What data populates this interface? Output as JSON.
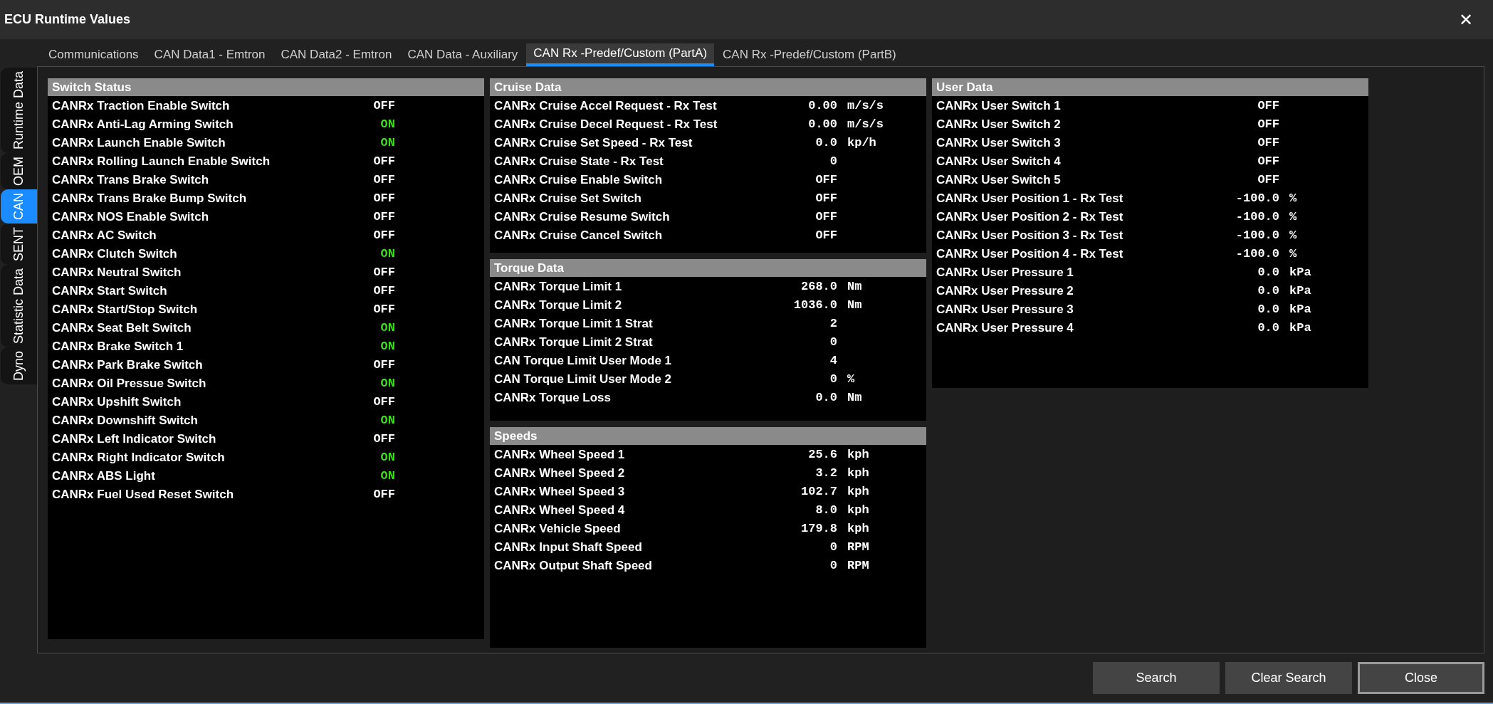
{
  "window": {
    "title": "ECU Runtime Values",
    "close": "✕"
  },
  "side_tabs": [
    {
      "label": "Runtime Data",
      "selected": false
    },
    {
      "label": "OEM",
      "selected": false
    },
    {
      "label": "CAN",
      "selected": true
    },
    {
      "label": "SENT",
      "selected": false
    },
    {
      "label": "Statistic Data",
      "selected": false
    },
    {
      "label": "Dyno",
      "selected": false
    }
  ],
  "tabs": [
    {
      "label": "Communications",
      "selected": false
    },
    {
      "label": "CAN Data1 - Emtron",
      "selected": false
    },
    {
      "label": "CAN Data2 - Emtron",
      "selected": false
    },
    {
      "label": "CAN Data - Auxiliary",
      "selected": false
    },
    {
      "label": "CAN Rx -Predef/Custom (PartA)",
      "selected": true
    },
    {
      "label": "CAN Rx -Predef/Custom (PartB)",
      "selected": false
    }
  ],
  "columns": [
    {
      "panels": [
        {
          "title": "Switch Status",
          "rows": [
            {
              "label": "CANRx Traction Enable Switch",
              "value": "OFF",
              "on": false
            },
            {
              "label": "CANRx Anti-Lag Arming Switch",
              "value": "ON",
              "on": true
            },
            {
              "label": "CANRx Launch Enable Switch",
              "value": "ON",
              "on": true
            },
            {
              "label": "CANRx Rolling Launch Enable Switch",
              "value": "OFF",
              "on": false
            },
            {
              "label": "CANRx Trans Brake Switch",
              "value": "OFF",
              "on": false
            },
            {
              "label": "CANRx Trans Brake Bump Switch",
              "value": "OFF",
              "on": false
            },
            {
              "label": "CANRx NOS Enable Switch",
              "value": "OFF",
              "on": false
            },
            {
              "label": "CANRx AC Switch",
              "value": "OFF",
              "on": false
            },
            {
              "label": "CANRx Clutch Switch",
              "value": "ON",
              "on": true
            },
            {
              "label": "CANRx Neutral Switch",
              "value": "OFF",
              "on": false
            },
            {
              "label": "CANRx Start Switch",
              "value": "OFF",
              "on": false
            },
            {
              "label": "CANRx Start/Stop Switch",
              "value": "OFF",
              "on": false
            },
            {
              "label": "CANRx Seat Belt Switch",
              "value": "ON",
              "on": true
            },
            {
              "label": "CANRx Brake Switch 1",
              "value": "ON",
              "on": true
            },
            {
              "label": "CANRx Park Brake Switch",
              "value": "OFF",
              "on": false
            },
            {
              "label": "CANRx Oil Pressue Switch",
              "value": "ON",
              "on": true
            },
            {
              "label": "CANRx Upshift Switch",
              "value": "OFF",
              "on": false
            },
            {
              "label": "CANRx Downshift Switch",
              "value": "ON",
              "on": true
            },
            {
              "label": "CANRx Left Indicator Switch",
              "value": "OFF",
              "on": false
            },
            {
              "label": "CANRx Right Indicator Switch",
              "value": "ON",
              "on": true
            },
            {
              "label": "CANRx ABS Light",
              "value": "ON",
              "on": true
            },
            {
              "label": "CANRx Fuel Used Reset Switch",
              "value": "OFF",
              "on": false
            }
          ]
        }
      ]
    },
    {
      "panels": [
        {
          "title": "Cruise Data",
          "rows": [
            {
              "label": "CANRx Cruise Accel Request - Rx Test",
              "value": "0.00",
              "unit": "m/s/s"
            },
            {
              "label": "CANRx Cruise Decel Request - Rx Test",
              "value": "0.00",
              "unit": "m/s/s"
            },
            {
              "label": "CANRx Cruise Set Speed - Rx Test",
              "value": "0.0",
              "unit": "kp/h"
            },
            {
              "label": "CANRx Cruise State - Rx Test",
              "value": "0"
            },
            {
              "label": "CANRx Cruise Enable Switch",
              "value": "OFF",
              "on": false
            },
            {
              "label": "CANRx Cruise Set Switch",
              "value": "OFF",
              "on": false
            },
            {
              "label": "CANRx Cruise Resume Switch",
              "value": "OFF",
              "on": false
            },
            {
              "label": "CANRx Cruise Cancel Switch",
              "value": "OFF",
              "on": false
            }
          ]
        },
        {
          "title": "Torque Data",
          "rows": [
            {
              "label": "CANRx Torque Limit 1",
              "value": "268.0",
              "unit": "Nm"
            },
            {
              "label": "CANRx Torque Limit 2",
              "value": "1036.0",
              "unit": "Nm"
            },
            {
              "label": "CANRx Torque Limit 1 Strat",
              "value": "2"
            },
            {
              "label": "CANRx Torque Limit 2 Strat",
              "value": "0"
            },
            {
              "label": "CAN Torque Limit User Mode 1",
              "value": "4"
            },
            {
              "label": "CAN Torque Limit User Mode 2",
              "value": "0",
              "unit": "%"
            },
            {
              "label": "CANRx Torque Loss",
              "value": "0.0",
              "unit": "Nm"
            }
          ]
        },
        {
          "title": "Speeds",
          "rows": [
            {
              "label": "CANRx Wheel Speed 1",
              "value": "25.6",
              "unit": "kph"
            },
            {
              "label": "CANRx Wheel Speed 2",
              "value": "3.2",
              "unit": "kph"
            },
            {
              "label": "CANRx Wheel Speed 3",
              "value": "102.7",
              "unit": "kph"
            },
            {
              "label": "CANRx Wheel Speed 4",
              "value": "8.0",
              "unit": "kph"
            },
            {
              "label": "CANRx Vehicle Speed",
              "value": "179.8",
              "unit": "kph"
            },
            {
              "label": "CANRx Input Shaft Speed",
              "value": "0",
              "unit": "RPM"
            },
            {
              "label": "CANRx Output Shaft Speed",
              "value": "0",
              "unit": "RPM"
            }
          ]
        }
      ]
    },
    {
      "panels": [
        {
          "title": "User Data",
          "rows": [
            {
              "label": "CANRx User Switch 1",
              "value": "OFF",
              "on": false
            },
            {
              "label": "CANRx User Switch 2",
              "value": "OFF",
              "on": false
            },
            {
              "label": "CANRx User Switch 3",
              "value": "OFF",
              "on": false
            },
            {
              "label": "CANRx User Switch 4",
              "value": "OFF",
              "on": false
            },
            {
              "label": "CANRx User Switch 5",
              "value": "OFF",
              "on": false
            },
            {
              "label": "CANRx User Position 1 - Rx Test",
              "value": "-100.0",
              "unit": "%"
            },
            {
              "label": "CANRx User Position 2 - Rx Test",
              "value": "-100.0",
              "unit": "%"
            },
            {
              "label": "CANRx User Position 3 - Rx Test",
              "value": "-100.0",
              "unit": "%"
            },
            {
              "label": "CANRx User Position 4 - Rx Test",
              "value": "-100.0",
              "unit": "%"
            },
            {
              "label": "CANRx User Pressure 1",
              "value": "0.0",
              "unit": "kPa"
            },
            {
              "label": "CANRx User Pressure 2",
              "value": "0.0",
              "unit": "kPa"
            },
            {
              "label": "CANRx User Pressure 3",
              "value": "0.0",
              "unit": "kPa"
            },
            {
              "label": "CANRx User Pressure 4",
              "value": "0.0",
              "unit": "kPa"
            }
          ]
        }
      ]
    }
  ],
  "buttons": [
    {
      "label": "Search",
      "kind": "normal"
    },
    {
      "label": "Clear Search",
      "kind": "normal"
    },
    {
      "label": "Close",
      "kind": "default"
    }
  ]
}
